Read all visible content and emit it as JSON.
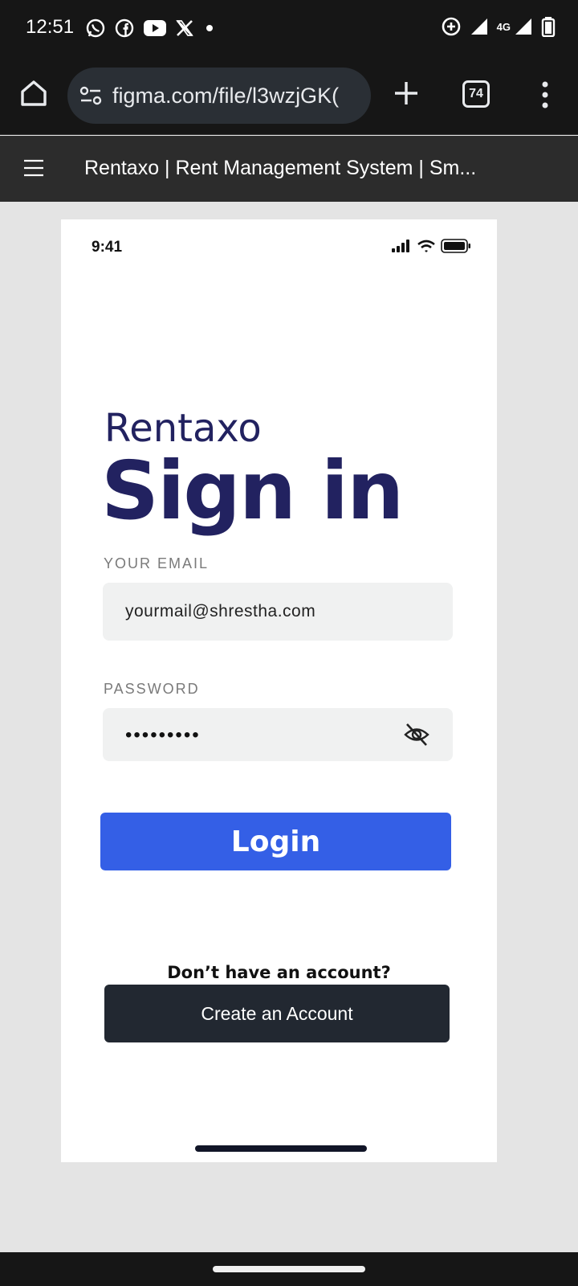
{
  "status_bar": {
    "time": "12:51",
    "app_icons": [
      "whatsapp-icon",
      "facebook-icon",
      "youtube-icon",
      "x-icon",
      "dot-icon"
    ],
    "right_icons": [
      "data-saver-icon",
      "signal-icon",
      "4g-signal-icon",
      "battery-icon"
    ],
    "network_label": "4G"
  },
  "browser": {
    "url": "figma.com/file/l3wzjGK(",
    "tab_count": "74"
  },
  "figma": {
    "title": "Rentaxo | Rent Management System | Sm..."
  },
  "frame": {
    "status_time": "9:41",
    "brand": "Rentaxo",
    "heading": "Sign in",
    "email_label": "YOUR EMAIL",
    "email_value": "yourmail@shrestha.com",
    "password_label": "PASSWORD",
    "password_value": "•••••••••",
    "login_label": "Login",
    "no_account_text": "Don’t have an account?",
    "create_account_label": "Create an Account"
  },
  "colors": {
    "brand_navy": "#222260",
    "login_blue": "#345fe6",
    "dark_button": "#222831",
    "input_bg": "#f0f1f1"
  }
}
